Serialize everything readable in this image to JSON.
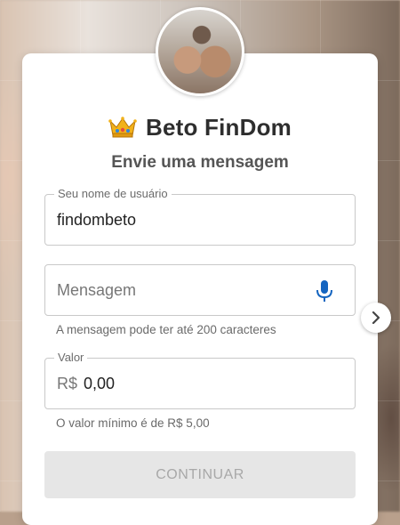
{
  "profile": {
    "name": "Beto FinDom",
    "crown_emoji": "👑",
    "subtitle": "Envie uma mensagem"
  },
  "username_field": {
    "label": "Seu nome de usuário",
    "value": "findombeto"
  },
  "message_field": {
    "placeholder": "Mensagem",
    "help": "A mensagem pode ter até 200 caracteres",
    "icon": "microphone-icon"
  },
  "value_field": {
    "label": "Valor",
    "currency_prefix": "R$",
    "value": "0,00",
    "help": "O valor mínimo é de R$ 5,00"
  },
  "continue_button": {
    "label": "CONTINUAR"
  },
  "colors": {
    "mic_blue": "#1565c0",
    "button_disabled_bg": "#e6e6e6",
    "button_disabled_text": "#a8a8a8"
  }
}
